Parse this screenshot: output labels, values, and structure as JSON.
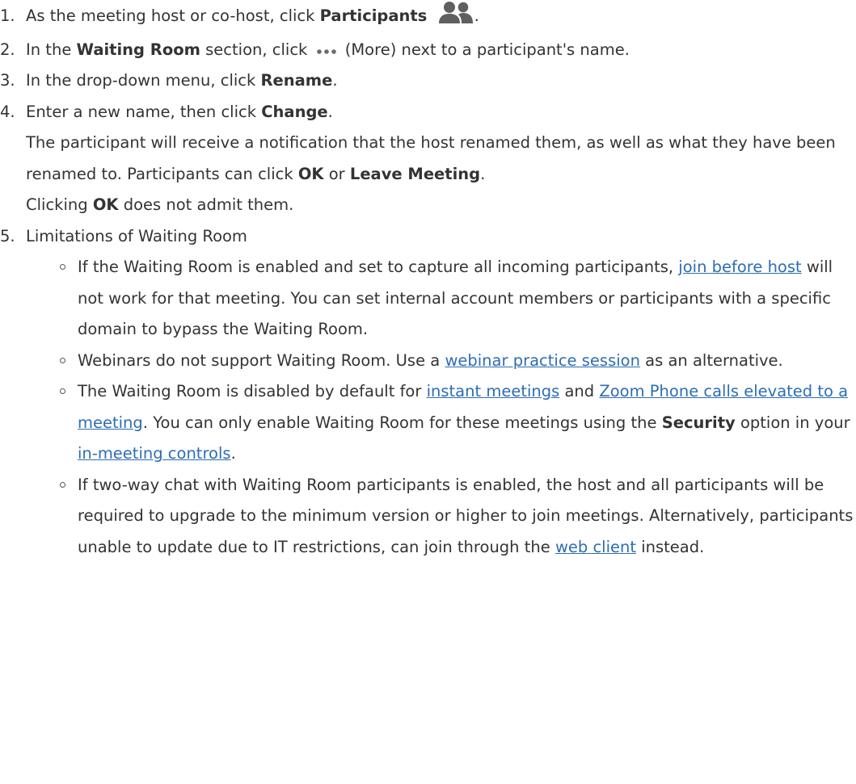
{
  "steps": [
    {
      "num": "1.",
      "text_a": "As the meeting host or co-host, click ",
      "bold": "Participants",
      "text_b": ".",
      "icon": "participants-icon"
    },
    {
      "num": "2.",
      "text_a": "In the ",
      "bold": "Waiting Room",
      "text_b": " section, click ",
      "icon": "more-icon",
      "text_c": " (More) next to a participant's name."
    },
    {
      "num": "3.",
      "text_a": "In the drop-down menu, click ",
      "bold": "Rename",
      "text_b": "."
    },
    {
      "num": "4.",
      "text_a": "Enter a new name, then click ",
      "bold": "Change",
      "text_b": ".",
      "note_a": "The participant will receive a notification that the host renamed them, as well as what they have been renamed to. Participants can click ",
      "note_bold1": "OK",
      "note_b": " or ",
      "note_bold2": "Leave Meeting",
      "note_c": ".",
      "note2_a": "Clicking ",
      "note2_bold": "OK",
      "note2_b": " does not admit them."
    },
    {
      "num": "5.",
      "text_a": "Limitations of Waiting Room"
    }
  ],
  "limitations": [
    {
      "a": "If the Waiting Room is enabled and set to capture all incoming participants, ",
      "link": "join before host",
      "b": " will not work for that meeting. You can set internal account members or participants with a specific domain to bypass the Waiting Room."
    },
    {
      "a": "Webinars do not support Waiting Room. Use a ",
      "link": "webinar practice session",
      "b": " as an alternative."
    },
    {
      "a": "The Waiting Room is disabled by default for ",
      "link1": "instant meetings",
      "b": " and ",
      "link2": "Zoom Phone calls elevated to a meeting",
      "c": ". You can only enable Waiting Room for these meetings using the ",
      "bold": "Security",
      "d": " option in your ",
      "link3": "in-meeting controls",
      "e": "."
    },
    {
      "a": "If two-way chat with Waiting Room participants is enabled, the host and all participants will be required to upgrade to the minimum version or higher to join meetings. Alternatively, participants unable to update due to IT restrictions, can join through the ",
      "link": "web client",
      "b": " instead."
    }
  ],
  "colors": {
    "text": "#333333",
    "link": "#2d6db4",
    "icon": "#5f5f5f"
  }
}
